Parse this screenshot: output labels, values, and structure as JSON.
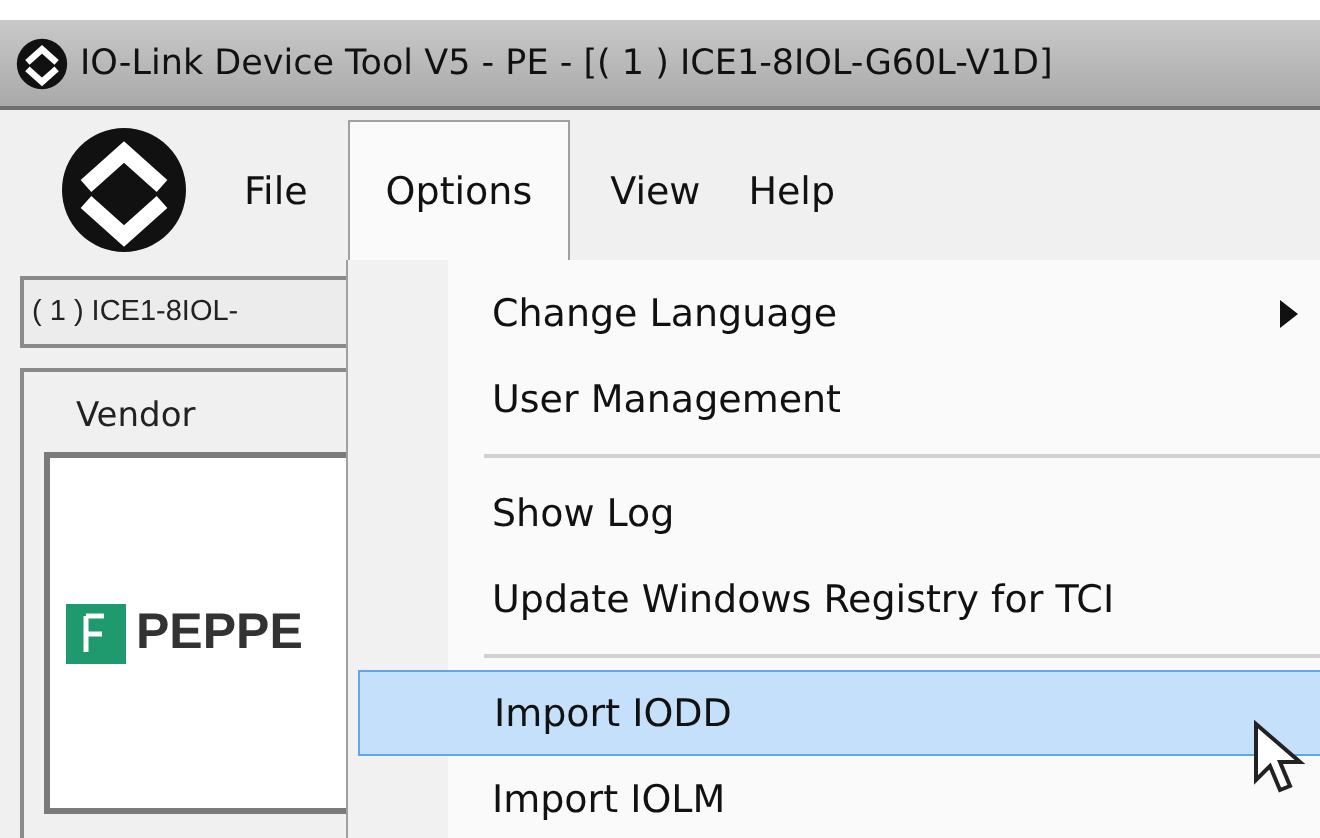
{
  "window": {
    "title": "IO-Link Device Tool V5 - PE - [( 1 ) ICE1-8IOL-G60L-V1D]"
  },
  "menu_bar": [
    {
      "label": "File",
      "selected": false
    },
    {
      "label": "Options",
      "selected": true
    },
    {
      "label": "View",
      "selected": false
    },
    {
      "label": "Help",
      "selected": false
    }
  ],
  "device_selector": {
    "value": "( 1 ) ICE1-8IOL-"
  },
  "vendor_panel": {
    "title": "Vendor",
    "logo_text": "PEPPE"
  },
  "options_menu": [
    {
      "kind": "submenu",
      "label": "Change Language",
      "selected": false
    },
    {
      "kind": "item",
      "label": "User Management",
      "selected": false
    },
    {
      "kind": "separator"
    },
    {
      "kind": "item",
      "label": "Show Log",
      "selected": false
    },
    {
      "kind": "item",
      "label": "Update Windows Registry for TCI",
      "selected": false
    },
    {
      "kind": "separator"
    },
    {
      "kind": "item",
      "label": "Import IODD",
      "selected": true
    },
    {
      "kind": "item",
      "label": "Import IOLM",
      "selected": false
    }
  ]
}
